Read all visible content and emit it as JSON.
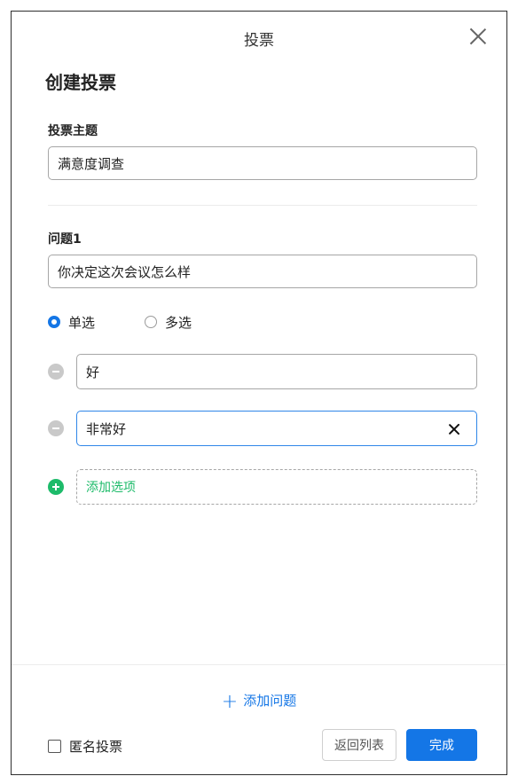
{
  "dialog": {
    "title": "投票",
    "heading": "创建投票"
  },
  "topic": {
    "label": "投票主题",
    "value": "满意度调查"
  },
  "question": {
    "label": "问题1",
    "value": "你决定这次会议怎么样",
    "type_single": "单选",
    "type_multiple": "多选",
    "selected_type": "单选",
    "options": [
      {
        "value": "好"
      },
      {
        "value": "非常好"
      }
    ],
    "add_option_placeholder": "添加选项"
  },
  "footer": {
    "add_question_label": "添加问题",
    "anonymous_label": "匿名投票",
    "anonymous_checked": false,
    "back_label": "返回列表",
    "done_label": "完成"
  },
  "colors": {
    "accent": "#1476e6",
    "add_green": "#1dbb6a",
    "remove_gray": "#c9c9c9"
  }
}
